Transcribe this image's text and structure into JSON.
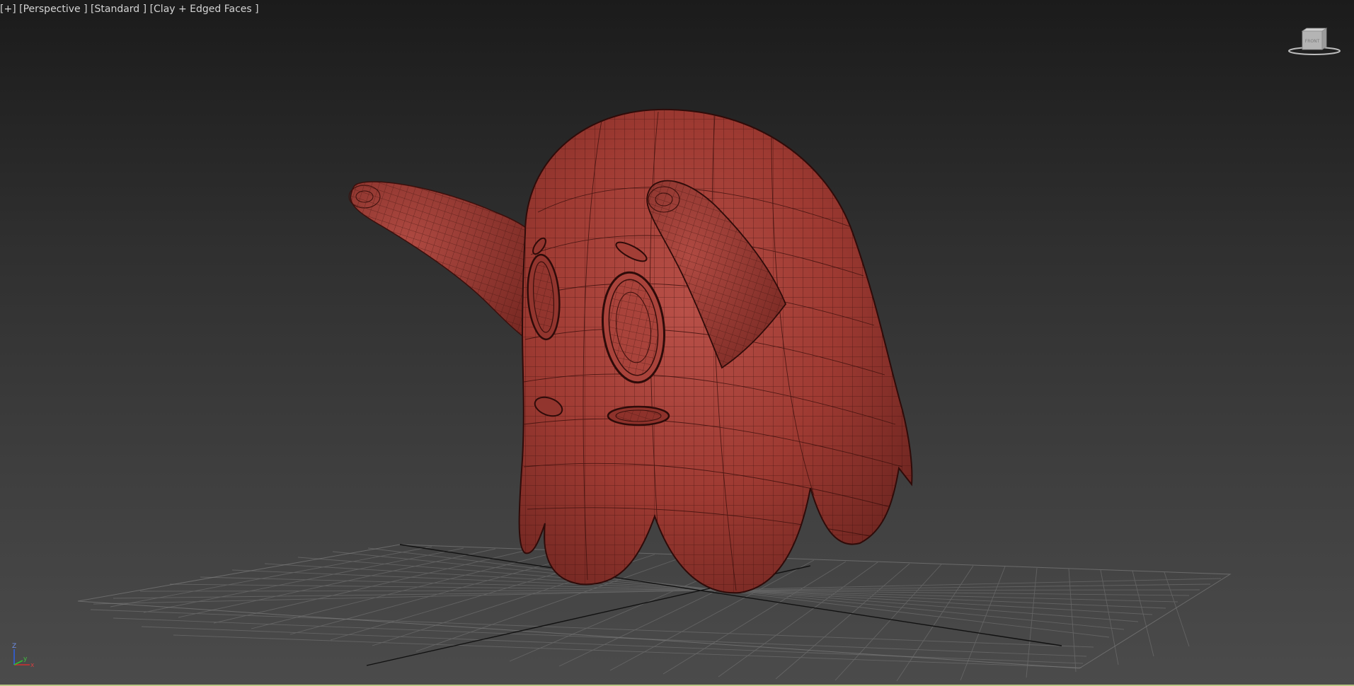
{
  "viewport": {
    "label_plus": "[+]",
    "label_view": "[Perspective ]",
    "label_shading_preset": "[Standard ]",
    "label_display_mode": "[Clay + Edged Faces ]"
  },
  "viewcube": {
    "face_label": "FRONT"
  },
  "axis_tripod": {
    "z_label": "Z",
    "x_label": "x",
    "y_label": "y"
  },
  "colors": {
    "mesh_fill": "#9e3a32",
    "mesh_edge": "#3a0f0c",
    "grid_line": "#8a8a8a",
    "grid_axis": "#111111",
    "background_top": "#1b1b1b",
    "background_bottom": "#4b4b4b",
    "axis_x": "#d03030",
    "axis_y": "#30c030",
    "axis_z": "#3060e0",
    "status_accent": "#b9c785"
  },
  "icons": {
    "viewcube": "viewcube-icon",
    "tripod": "axis-tripod-icon"
  }
}
